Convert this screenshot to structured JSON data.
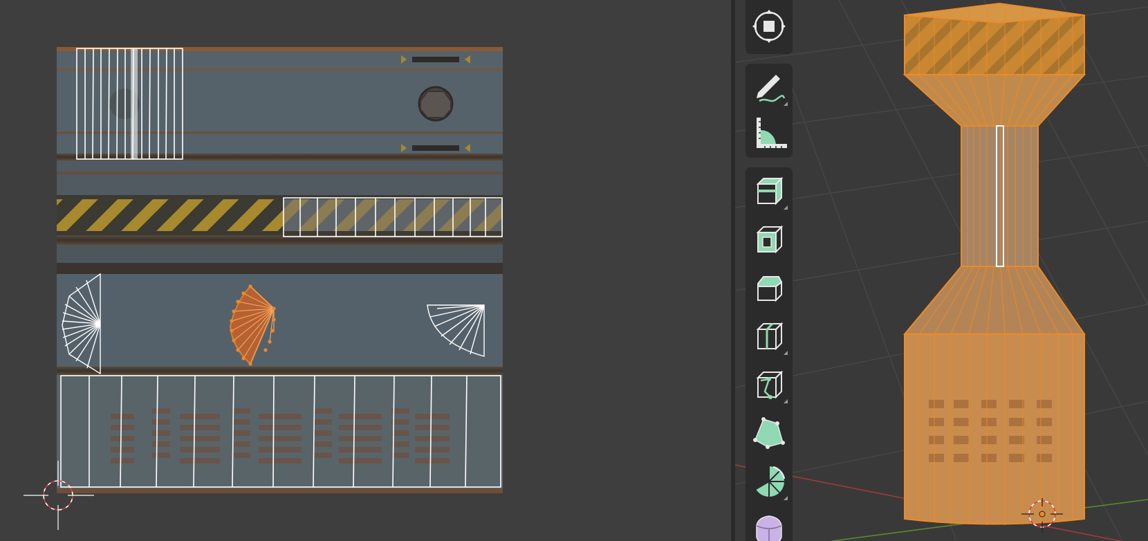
{
  "app": {
    "editors": [
      "uv-editor",
      "3d-viewport"
    ]
  },
  "colors": {
    "uv_editor_bg": "#3e3e3e",
    "viewport_bg": "#393939",
    "toolbar_bg": "#2b2b2b",
    "selection_orange": "#f08a24",
    "uv_edge_white": "#ffffff",
    "tool_accent_green": "#8fd9b3",
    "tool_accent_purple": "#c9b3e6",
    "grid_line": "#4a4a4a",
    "axis_x_red": "#a03a3a",
    "axis_y_green": "#5b8a2f"
  },
  "uv_editor": {
    "texture": "rusted-metal-panels-with-hazard-stripes",
    "selected_island": "fan-island-center"
  },
  "viewport": {
    "object": "cylinder-with-tapered-sections",
    "object_state": "selected-edit-mode"
  },
  "toolbar": {
    "tools": [
      {
        "id": "transform",
        "icon": "transform-icon",
        "active": false
      },
      {
        "id": "annotate",
        "icon": "annotate-icon",
        "active": false
      },
      {
        "id": "measure",
        "icon": "measure-icon",
        "active": false
      },
      {
        "id": "add-cube",
        "icon": "add-cube-icon",
        "active": false
      },
      {
        "id": "inset-faces",
        "icon": "inset-faces-icon",
        "active": false
      },
      {
        "id": "bevel",
        "icon": "bevel-icon",
        "active": false
      },
      {
        "id": "loop-cut",
        "icon": "loop-cut-icon",
        "active": false
      },
      {
        "id": "knife",
        "icon": "knife-icon",
        "active": false
      },
      {
        "id": "poly-build",
        "icon": "poly-build-icon",
        "active": false
      },
      {
        "id": "spin",
        "icon": "spin-icon",
        "active": false
      },
      {
        "id": "smooth",
        "icon": "smooth-icon",
        "active": false
      }
    ]
  }
}
